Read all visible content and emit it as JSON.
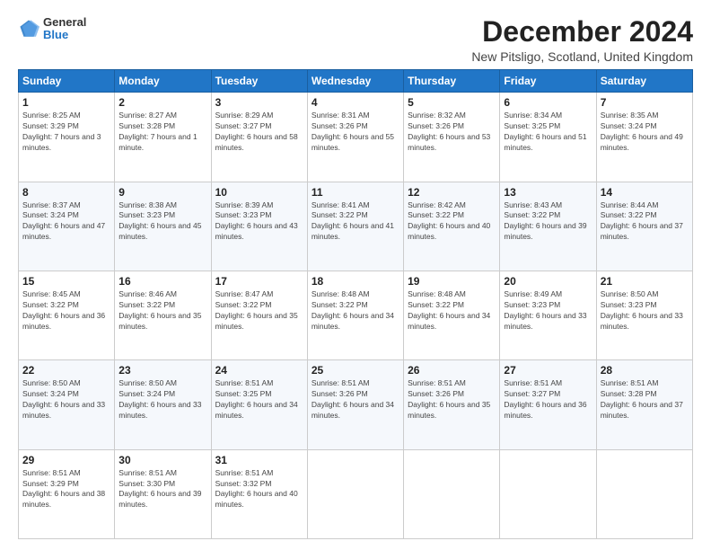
{
  "logo": {
    "general": "General",
    "blue": "Blue"
  },
  "title": "December 2024",
  "location": "New Pitsligo, Scotland, United Kingdom",
  "days_of_week": [
    "Sunday",
    "Monday",
    "Tuesday",
    "Wednesday",
    "Thursday",
    "Friday",
    "Saturday"
  ],
  "weeks": [
    [
      {
        "day": "1",
        "sunrise": "8:25 AM",
        "sunset": "3:29 PM",
        "daylight": "7 hours and 3 minutes."
      },
      {
        "day": "2",
        "sunrise": "8:27 AM",
        "sunset": "3:28 PM",
        "daylight": "7 hours and 1 minute."
      },
      {
        "day": "3",
        "sunrise": "8:29 AM",
        "sunset": "3:27 PM",
        "daylight": "6 hours and 58 minutes."
      },
      {
        "day": "4",
        "sunrise": "8:31 AM",
        "sunset": "3:26 PM",
        "daylight": "6 hours and 55 minutes."
      },
      {
        "day": "5",
        "sunrise": "8:32 AM",
        "sunset": "3:26 PM",
        "daylight": "6 hours and 53 minutes."
      },
      {
        "day": "6",
        "sunrise": "8:34 AM",
        "sunset": "3:25 PM",
        "daylight": "6 hours and 51 minutes."
      },
      {
        "day": "7",
        "sunrise": "8:35 AM",
        "sunset": "3:24 PM",
        "daylight": "6 hours and 49 minutes."
      }
    ],
    [
      {
        "day": "8",
        "sunrise": "8:37 AM",
        "sunset": "3:24 PM",
        "daylight": "6 hours and 47 minutes."
      },
      {
        "day": "9",
        "sunrise": "8:38 AM",
        "sunset": "3:23 PM",
        "daylight": "6 hours and 45 minutes."
      },
      {
        "day": "10",
        "sunrise": "8:39 AM",
        "sunset": "3:23 PM",
        "daylight": "6 hours and 43 minutes."
      },
      {
        "day": "11",
        "sunrise": "8:41 AM",
        "sunset": "3:22 PM",
        "daylight": "6 hours and 41 minutes."
      },
      {
        "day": "12",
        "sunrise": "8:42 AM",
        "sunset": "3:22 PM",
        "daylight": "6 hours and 40 minutes."
      },
      {
        "day": "13",
        "sunrise": "8:43 AM",
        "sunset": "3:22 PM",
        "daylight": "6 hours and 39 minutes."
      },
      {
        "day": "14",
        "sunrise": "8:44 AM",
        "sunset": "3:22 PM",
        "daylight": "6 hours and 37 minutes."
      }
    ],
    [
      {
        "day": "15",
        "sunrise": "8:45 AM",
        "sunset": "3:22 PM",
        "daylight": "6 hours and 36 minutes."
      },
      {
        "day": "16",
        "sunrise": "8:46 AM",
        "sunset": "3:22 PM",
        "daylight": "6 hours and 35 minutes."
      },
      {
        "day": "17",
        "sunrise": "8:47 AM",
        "sunset": "3:22 PM",
        "daylight": "6 hours and 35 minutes."
      },
      {
        "day": "18",
        "sunrise": "8:48 AM",
        "sunset": "3:22 PM",
        "daylight": "6 hours and 34 minutes."
      },
      {
        "day": "19",
        "sunrise": "8:48 AM",
        "sunset": "3:22 PM",
        "daylight": "6 hours and 34 minutes."
      },
      {
        "day": "20",
        "sunrise": "8:49 AM",
        "sunset": "3:23 PM",
        "daylight": "6 hours and 33 minutes."
      },
      {
        "day": "21",
        "sunrise": "8:50 AM",
        "sunset": "3:23 PM",
        "daylight": "6 hours and 33 minutes."
      }
    ],
    [
      {
        "day": "22",
        "sunrise": "8:50 AM",
        "sunset": "3:24 PM",
        "daylight": "6 hours and 33 minutes."
      },
      {
        "day": "23",
        "sunrise": "8:50 AM",
        "sunset": "3:24 PM",
        "daylight": "6 hours and 33 minutes."
      },
      {
        "day": "24",
        "sunrise": "8:51 AM",
        "sunset": "3:25 PM",
        "daylight": "6 hours and 34 minutes."
      },
      {
        "day": "25",
        "sunrise": "8:51 AM",
        "sunset": "3:26 PM",
        "daylight": "6 hours and 34 minutes."
      },
      {
        "day": "26",
        "sunrise": "8:51 AM",
        "sunset": "3:26 PM",
        "daylight": "6 hours and 35 minutes."
      },
      {
        "day": "27",
        "sunrise": "8:51 AM",
        "sunset": "3:27 PM",
        "daylight": "6 hours and 36 minutes."
      },
      {
        "day": "28",
        "sunrise": "8:51 AM",
        "sunset": "3:28 PM",
        "daylight": "6 hours and 37 minutes."
      }
    ],
    [
      {
        "day": "29",
        "sunrise": "8:51 AM",
        "sunset": "3:29 PM",
        "daylight": "6 hours and 38 minutes."
      },
      {
        "day": "30",
        "sunrise": "8:51 AM",
        "sunset": "3:30 PM",
        "daylight": "6 hours and 39 minutes."
      },
      {
        "day": "31",
        "sunrise": "8:51 AM",
        "sunset": "3:32 PM",
        "daylight": "6 hours and 40 minutes."
      },
      null,
      null,
      null,
      null
    ]
  ]
}
